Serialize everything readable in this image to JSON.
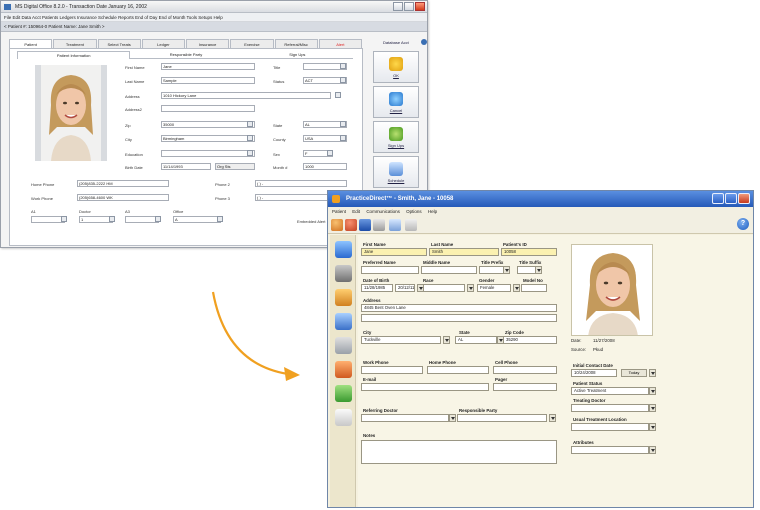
{
  "old_window": {
    "title": "MS Digital Office 8.2.0 - Transaction Date January 16, 2002",
    "menu": "File  Edit  Data Acct  Patients  Ledgers  Insurance  Schedule  Reports  End of Day  End of Month  Tools  Setups  Help",
    "patient_bar": "< Patient #: 150964-0     Patient Name: Jane Smith  >",
    "tabs": [
      "Patient",
      "Treatment",
      "Select Treats",
      "Ledger",
      "Insurance",
      "Exercise",
      "Referral/Misc",
      "Alert"
    ],
    "database_access": "Database Acct",
    "subtabs": [
      "Patient Information",
      "Responsible Party",
      "Sign Ups"
    ],
    "fields": {
      "first_name_label": "First Name",
      "first_name": "Jane",
      "last_name_label": "Last Name",
      "last_name": "Sample",
      "address_label": "Address",
      "address": "1010 Hickory Lane",
      "address2_label": "Address2",
      "address2": "",
      "zip_label": "Zip",
      "zip": "35000",
      "city_label": "City",
      "city": "Birmingham",
      "education_label": "Education",
      "education": "",
      "birth_date_label": "Birth Date",
      "birth_date": "11/14/1993",
      "age": "Org Sts",
      "title_label": "Title",
      "title": "",
      "status_label": "Status",
      "status": "ACT",
      "state_label": "State",
      "state": "AL",
      "county_label": "County",
      "county": "USA",
      "sex_label": "Sex",
      "sex": "F",
      "month_label": "Month #",
      "month": "1000",
      "home_phone_label": "Home Phone",
      "home_phone": "(205)835-2222 HM",
      "work_phone_label": "Work Phone",
      "work_phone": "(205)658-4600 WK",
      "phone2_label": "Phone 2",
      "phone2": "( ) -",
      "phone3_label": "Phone 3",
      "phone3": "( ) -",
      "a1_label": "A1",
      "a1": "",
      "doctor_label": "Doctor",
      "doctor": "1",
      "a3_label": "A3",
      "a3": "",
      "office_label": "Office",
      "office": "A",
      "employer_label": "Embedded Alert"
    },
    "side_buttons": [
      "OK",
      "Cancel",
      "Sign Ups",
      "Schedule"
    ]
  },
  "new_window": {
    "title": "PracticeDirect™ - Smith, Jane - 10058",
    "menu": [
      "Patient",
      "Edit",
      "Communications",
      "Options",
      "Help"
    ],
    "help_glyph": "?",
    "fields": {
      "first_name_label": "First Name",
      "first_name": "Jane",
      "last_name_label": "Last Name",
      "last_name": "Smith",
      "patient_id_label": "Patient's ID",
      "patient_id": "10058",
      "preferred_name_label": "Preferred Name",
      "preferred_name": "",
      "middle_name_label": "Middle Name",
      "middle_name": "",
      "title_prefix_label": "Title Prefix",
      "title_prefix": "",
      "title_suffix_label": "Title Suffix",
      "title_suffix": "",
      "dob_label": "Date of Birth",
      "dob": "11/28/1985",
      "dob_age": "20/12/11",
      "race_label": "Race",
      "race": "",
      "gender_label": "Gender",
      "gender": "Female",
      "model_label": "Model No",
      "model": "",
      "address_label": "Address",
      "address": "4845 Bent Oven Lane",
      "address2": "",
      "city_label": "City",
      "city": "Tuckville",
      "state_label": "State",
      "state": "AL",
      "zip_label": "Zip Code",
      "zip": "35290",
      "work_phone_label": "Work Phone",
      "home_phone_label": "Home Phone",
      "cell_phone_label": "Cell Phone",
      "email_label": "E-mail",
      "pager_label": "Pager",
      "referring_label": "Referring Doctor",
      "responsible_label": "Responsible Party",
      "notes_label": "Notes",
      "photo_date_label": "Date:",
      "photo_date": "11/27/2008",
      "photo_source_label": "Source:",
      "photo_source": "Pkud",
      "initial_contact_label": "Initial Contact Date",
      "initial_contact": "10/24/2008",
      "initial_contact_btn": "Today",
      "patient_status_label": "Patient Status",
      "patient_status": "Active Treatment",
      "treating_doctor_label": "Treating Doctor",
      "treating_doctor": "",
      "usual_location_label": "Usual Treatment Location",
      "usual_location": "",
      "attributes_label": "Attributes",
      "attributes": ""
    }
  },
  "colors": {
    "arrow": "#f0a020",
    "new_title": "#2559b8",
    "highlight": "#fbf1b0"
  }
}
